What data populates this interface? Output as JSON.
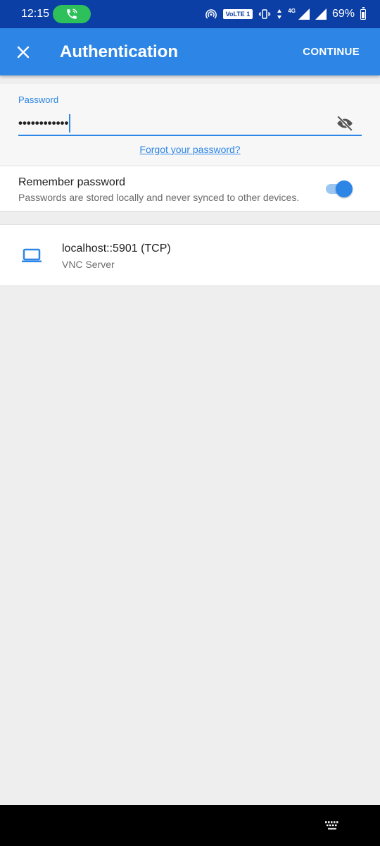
{
  "status_bar": {
    "time": "12:15",
    "volte_label": "VoLTE 1",
    "network_label": "4G",
    "battery_text": "69%"
  },
  "app_bar": {
    "title": "Authentication",
    "continue_label": "CONTINUE"
  },
  "password": {
    "label": "Password",
    "masked_value": "••••••••••••",
    "forgot_link": "Forgot your password?"
  },
  "remember": {
    "title": "Remember password",
    "subtitle": "Passwords are stored locally and never synced to other devices.",
    "enabled": true
  },
  "server": {
    "name": "localhost::5901 (TCP)",
    "type": "VNC Server"
  },
  "colors": {
    "status_bar": "#0c3fa6",
    "app_bar": "#2d86e6",
    "accent": "#2d86e6",
    "call_pill": "#2ec05a"
  }
}
